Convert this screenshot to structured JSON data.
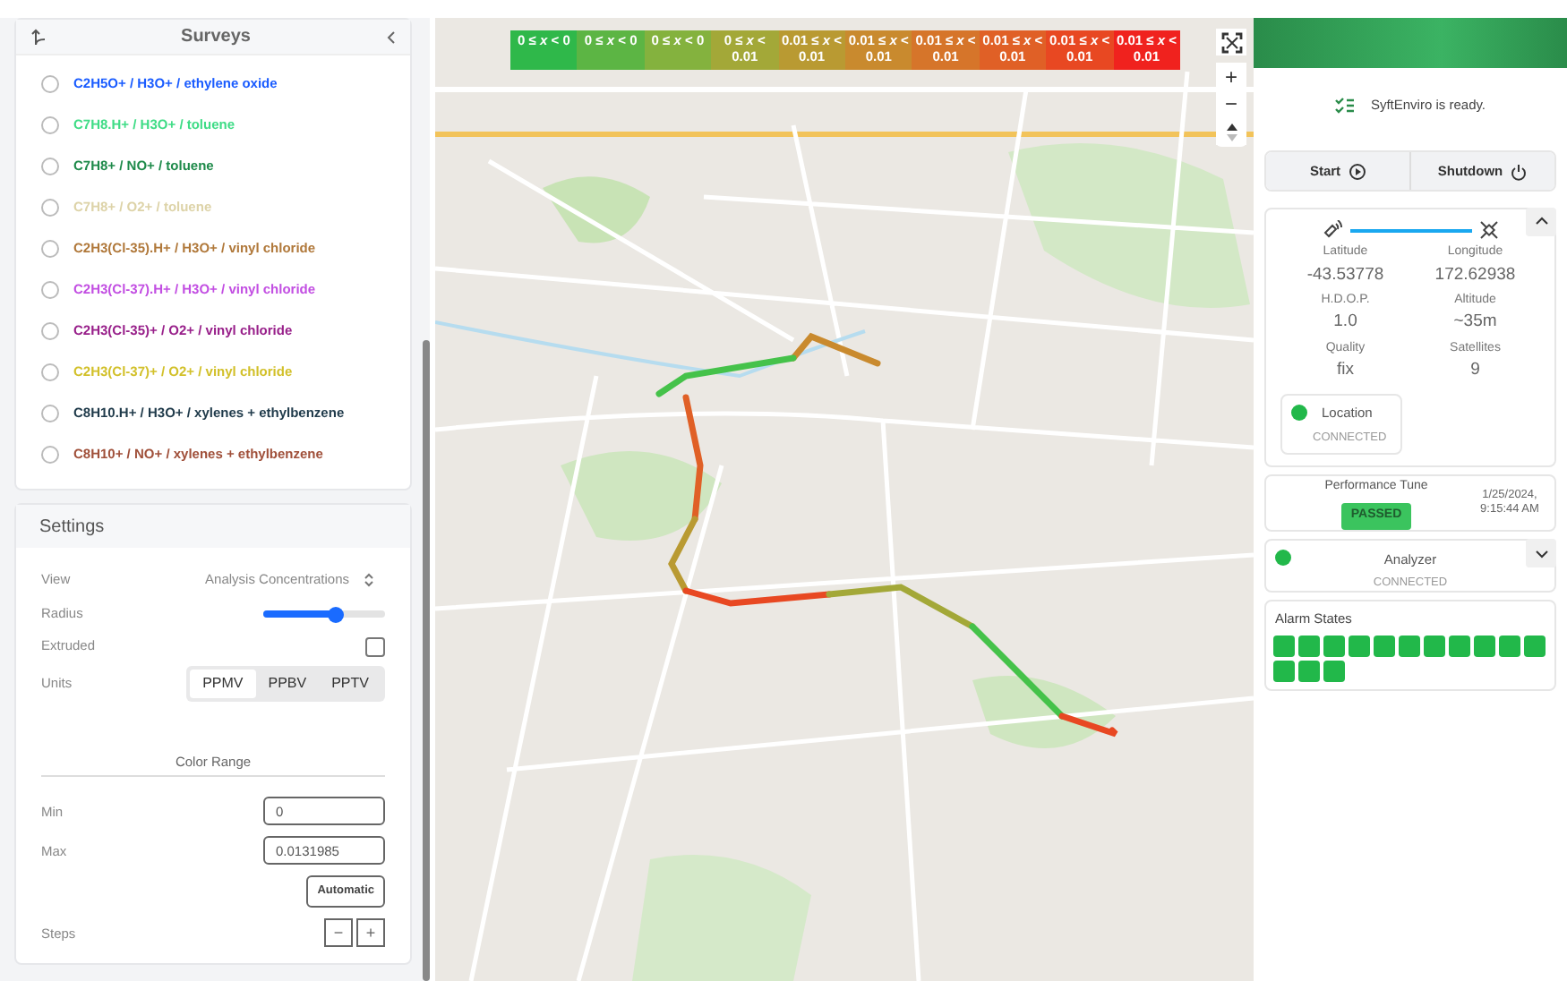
{
  "surveys": {
    "title": "Surveys",
    "items": [
      {
        "label": "C2H5O+ / H3O+ / ethylene oxide",
        "color": "#1a5cff",
        "selected": false
      },
      {
        "label": "C7H8.H+ / H3O+ / toluene",
        "color": "#3fdc86",
        "selected": false
      },
      {
        "label": "C7H8+ / NO+ / toluene",
        "color": "#1e8a4a",
        "selected": false
      },
      {
        "label": "C7H8+ / O2+ / toluene",
        "color": "#ddd3a8",
        "selected": false
      },
      {
        "label": "C2H3(Cl-35).H+ / H3O+ / vinyl chloride",
        "color": "#b0783a",
        "selected": false
      },
      {
        "label": "C2H3(Cl-37).H+ / H3O+ / vinyl chloride",
        "color": "#c24ee2",
        "selected": false
      },
      {
        "label": "C2H3(Cl-35)+ / O2+ / vinyl chloride",
        "color": "#98208a",
        "selected": false
      },
      {
        "label": "C2H3(Cl-37)+ / O2+ / vinyl chloride",
        "color": "#d2c02a",
        "selected": false
      },
      {
        "label": "C8H10.H+ / H3O+ / xylenes + ethylbenzene",
        "color": "#1f3a4a",
        "selected": false
      },
      {
        "label": "C8H10+ / NO+ / xylenes + ethylbenzene",
        "color": "#a0503a",
        "selected": false
      }
    ]
  },
  "settings": {
    "title": "Settings",
    "view": {
      "label": "View",
      "value": "Analysis Concentrations"
    },
    "radius": {
      "label": "Radius",
      "level": 0.6
    },
    "extruded": {
      "label": "Extruded",
      "checked": false
    },
    "units": {
      "label": "Units",
      "options": [
        {
          "label": "PPMV",
          "selected": true
        },
        {
          "label": "PPBV",
          "selected": false
        },
        {
          "label": "PPTV",
          "selected": false
        }
      ]
    },
    "color_range": {
      "title": "Color Range",
      "min_label": "Min",
      "min": "0",
      "max_label": "Max",
      "max": "0.0131985",
      "automatic": "Automatic"
    },
    "steps": {
      "label": "Steps",
      "minus": "−",
      "plus": "+"
    }
  },
  "legend": [
    {
      "label": "0 ≤ *x* < 0",
      "color": "#2fb84a"
    },
    {
      "label": "0 ≤ *x* < 0",
      "color": "#5cb544"
    },
    {
      "label": "0 ≤ *x* < 0",
      "color": "#84b23e"
    },
    {
      "label": "0 ≤ *x* < 0.01",
      "color": "#a3a838"
    },
    {
      "label": "0.01 ≤ *x* < 0.01",
      "color": "#b99a32"
    },
    {
      "label": "0.01 ≤ *x* < 0.01",
      "color": "#c98a2e"
    },
    {
      "label": "0.01 ≤ *x* < 0.01",
      "color": "#d6752a"
    },
    {
      "label": "0.01 ≤ *x* < 0.01",
      "color": "#e06026"
    },
    {
      "label": "0.01 ≤ *x* < 0.01",
      "color": "#e84822"
    },
    {
      "label": "0.01 ≤ *x* < 0.01",
      "color": "#f0221e"
    }
  ],
  "map_controls": {
    "zoom_in": "+",
    "zoom_out": "−"
  },
  "status": {
    "message": "SyftEnviro is ready.",
    "buttons": [
      "Start",
      "Shutdown"
    ]
  },
  "gps": {
    "fields": [
      {
        "label": "Latitude",
        "value": "-43.53778"
      },
      {
        "label": "Longitude",
        "value": "172.62938"
      },
      {
        "label": "H.D.O.P.",
        "value": "1.0"
      },
      {
        "label": "Altitude",
        "value": "~35m"
      },
      {
        "label": "Quality",
        "value": "fix"
      },
      {
        "label": "Satellites",
        "value": "9"
      }
    ],
    "expanded": true,
    "location": {
      "label": "Location",
      "status": "CONNECTED",
      "connected": true
    }
  },
  "performance": {
    "label": "Performance Tune",
    "result": "PASSED",
    "date": "1/25/2024, 9:15:44 AM"
  },
  "analyzer": {
    "label": "Analyzer",
    "status": "CONNECTED",
    "connected": true,
    "expanded": false
  },
  "alarms": {
    "title": "Alarm States",
    "items": [
      {
        "on": true
      },
      {
        "on": true
      },
      {
        "on": true
      },
      {
        "on": true
      },
      {
        "on": true
      },
      {
        "on": true
      },
      {
        "on": true
      },
      {
        "on": true
      },
      {
        "on": true
      },
      {
        "on": true
      },
      {
        "on": true
      },
      {
        "on": true
      },
      {
        "on": true
      },
      {
        "on": true
      }
    ]
  }
}
